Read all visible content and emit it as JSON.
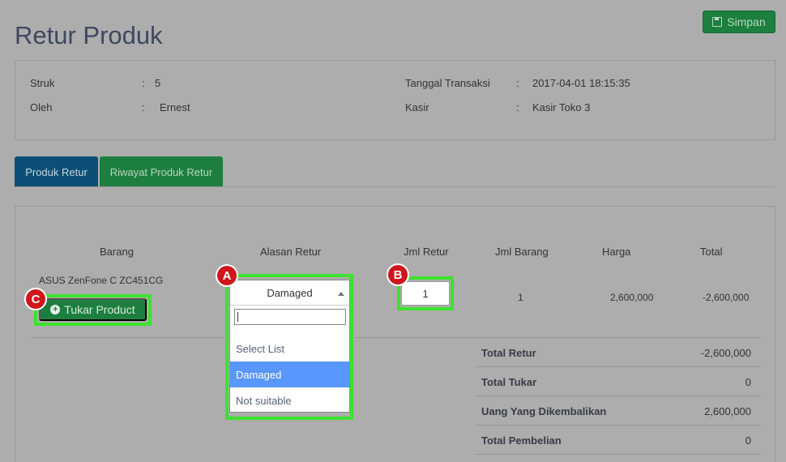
{
  "header": {
    "title": "Retur Produk",
    "save_label": "Simpan"
  },
  "info": {
    "struk_label": "Struk",
    "struk_value": "5",
    "oleh_label": "Oleh",
    "oleh_value": "Ernest",
    "tanggal_label": "Tanggal Transaksi",
    "tanggal_value": "2017-04-01 18:15:35",
    "kasir_label": "Kasir",
    "kasir_value": "Kasir Toko 3",
    "separator": ":"
  },
  "tabs": {
    "produk_retur": "Produk Retur",
    "riwayat": "Riwayat Produk Retur"
  },
  "table": {
    "columns": {
      "barang": "Barang",
      "alasan": "Alasan Retur",
      "jml_retur": "Jml Retur",
      "jml_barang": "Jml Barang",
      "harga": "Harga",
      "total": "Total"
    },
    "row": {
      "barang": "ASUS ZenFone C ZC451CG",
      "jml_barang": "1",
      "harga": "2,600,000",
      "total": "-2,600,000"
    }
  },
  "tukar_button": "Tukar Product",
  "dropdown": {
    "selected": "Damaged",
    "search_value": "",
    "options": [
      "Select List",
      "Damaged",
      "Not suitable"
    ]
  },
  "qty_value": "1",
  "summary": [
    {
      "label": "Total Retur",
      "value": "-2,600,000"
    },
    {
      "label": "Total Tukar",
      "value": "0"
    },
    {
      "label": "Uang Yang Dikembalikan",
      "value": "2,600,000"
    },
    {
      "label": "Total Pembelian",
      "value": "0"
    }
  ],
  "badges": {
    "a": "A",
    "b": "B",
    "c": "C"
  },
  "colors": {
    "highlight": "#3ee12f",
    "badge": "#d0151c",
    "option_active": "#5897fb"
  }
}
